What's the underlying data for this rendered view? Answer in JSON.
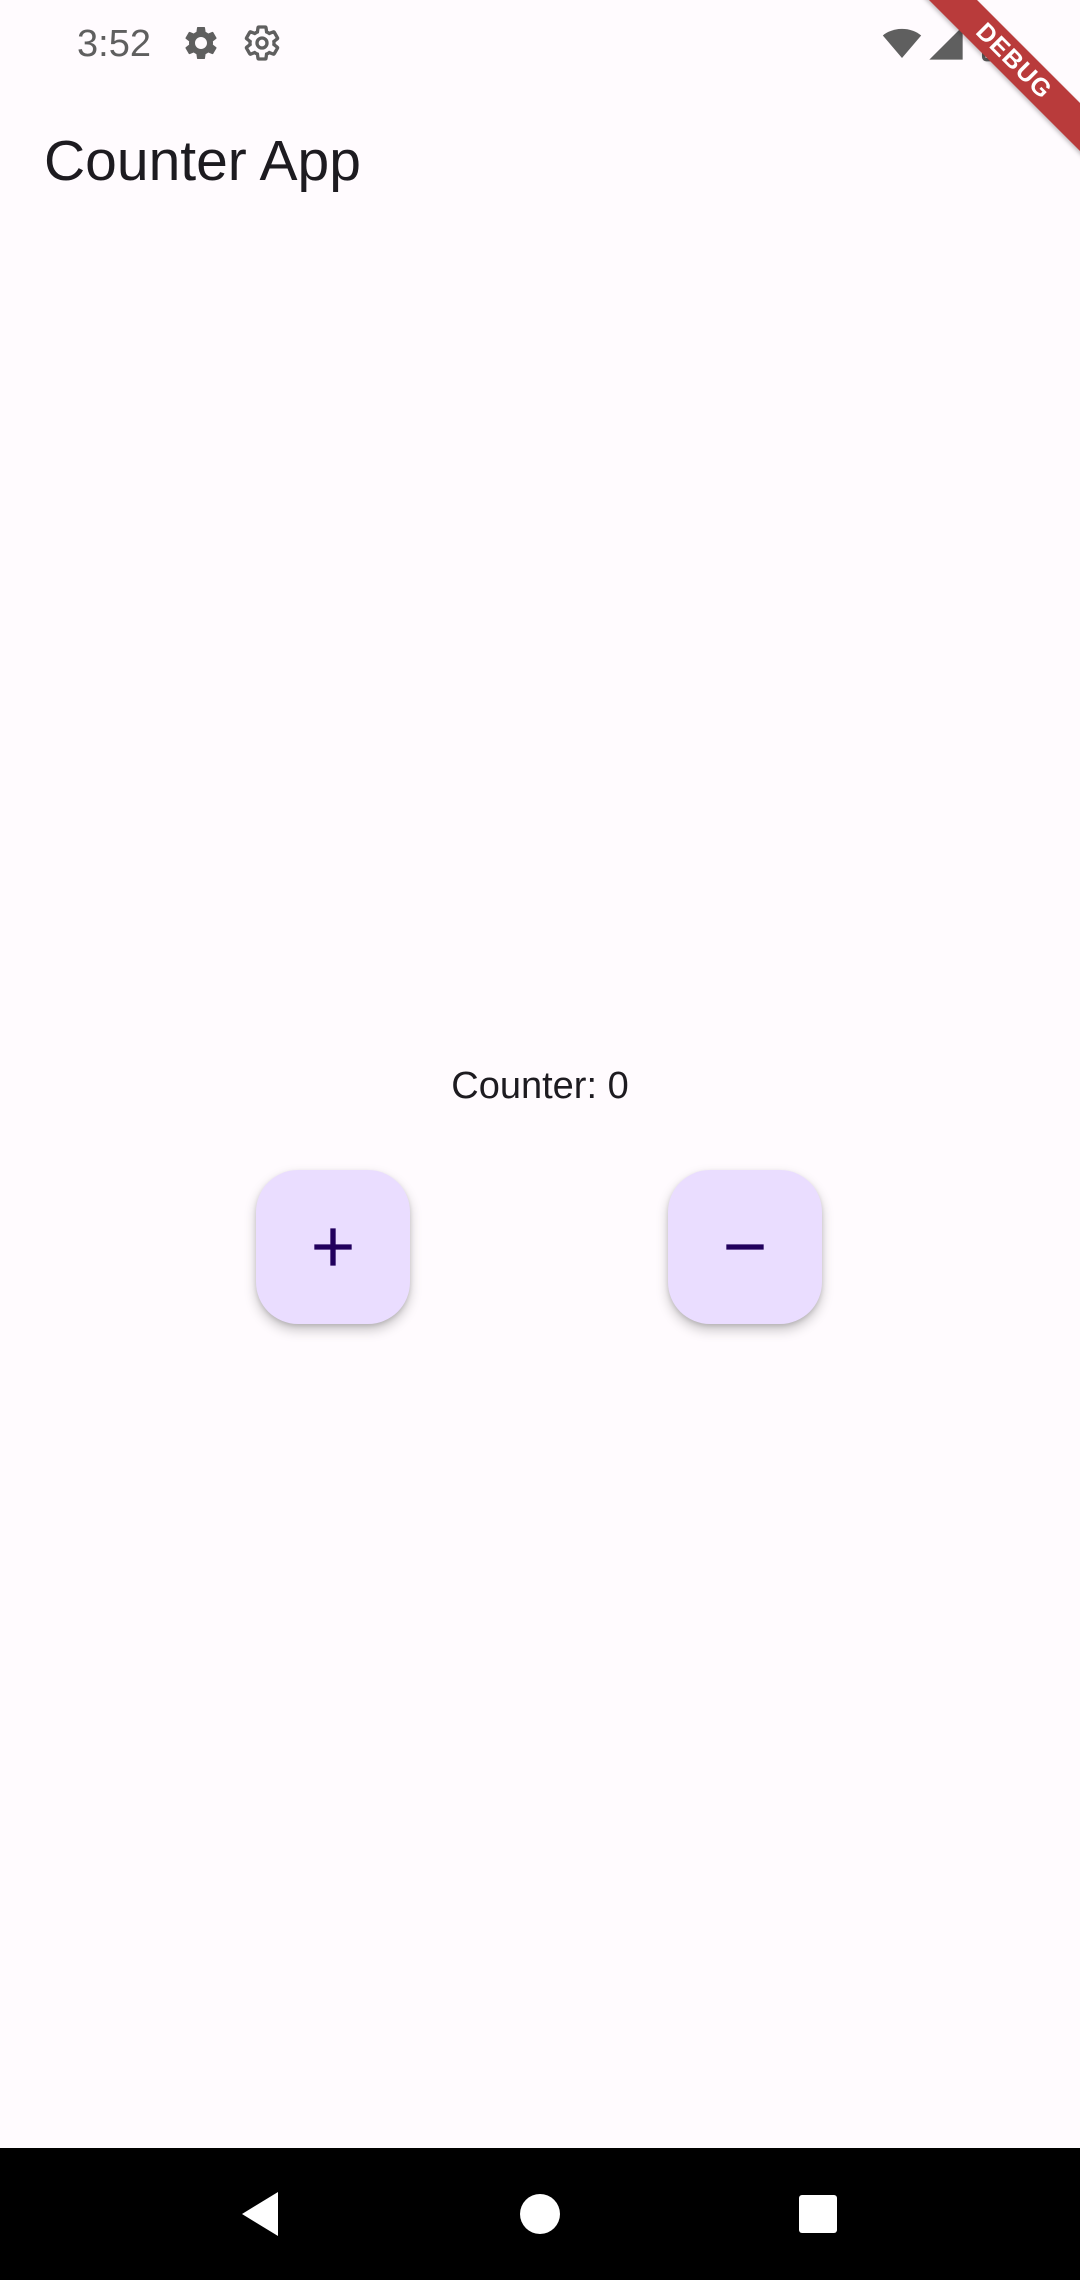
{
  "status_bar": {
    "time": "3:52",
    "icons": [
      "settings-gear-icon",
      "settings-outline-icon",
      "wifi-icon",
      "signal-icon",
      "battery-icon"
    ]
  },
  "debug_banner": {
    "label": "DEBUG",
    "color": "#b93b3b"
  },
  "app_bar": {
    "title": "Counter App"
  },
  "main": {
    "counter_label": "Counter: 0",
    "increment_button": {
      "icon": "plus-icon"
    },
    "decrement_button": {
      "icon": "minus-icon"
    }
  },
  "navigation": {
    "buttons": [
      "back-icon",
      "home-icon",
      "recents-icon"
    ]
  },
  "colors": {
    "background": "#fffbfe",
    "fab_background": "#eaddff",
    "fab_icon": "#21005d",
    "text": "#1d1b20",
    "nav_bar": "#000000"
  }
}
